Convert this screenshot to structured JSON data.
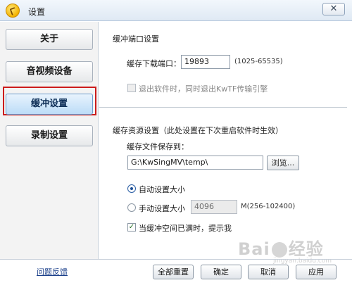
{
  "window": {
    "title": "设置",
    "close_glyph": "✕"
  },
  "sidebar": {
    "items": [
      {
        "label": "关于"
      },
      {
        "label": "音视频设备"
      },
      {
        "label": "缓冲设置"
      },
      {
        "label": "录制设置"
      }
    ],
    "active_index": 2,
    "feedback_link": "问题反馈"
  },
  "port_section": {
    "title": "缓冲端口设置",
    "port_label": "缓存下载端口：",
    "port_value": "19893",
    "port_range": "(1025-65535)",
    "exit_checkbox_label": "退出软件时，同时退出KwTF传输引擎",
    "exit_checkbox_checked": false
  },
  "resource_section": {
    "title": "缓存资源设置（此处设置在下次重启软件时生效）",
    "save_to_label": "缓存文件保存到：",
    "save_path": "G:\\KwSingMV\\temp\\",
    "browse_label": "浏览...",
    "auto_size_label": "自动设置大小",
    "auto_size_selected": true,
    "manual_size_label": "手动设置大小",
    "manual_size_value": "4096",
    "manual_size_hint": "M(256-102400)",
    "notify_label": "当缓冲空间已满时，提示我",
    "notify_checked": true
  },
  "footer": {
    "reset_all": "全部重置",
    "ok": "确定",
    "cancel": "取消",
    "apply": "应用"
  },
  "watermark": {
    "text_a": "Bai",
    "text_b": "经验",
    "sub": "jingyan.baidu.com"
  }
}
